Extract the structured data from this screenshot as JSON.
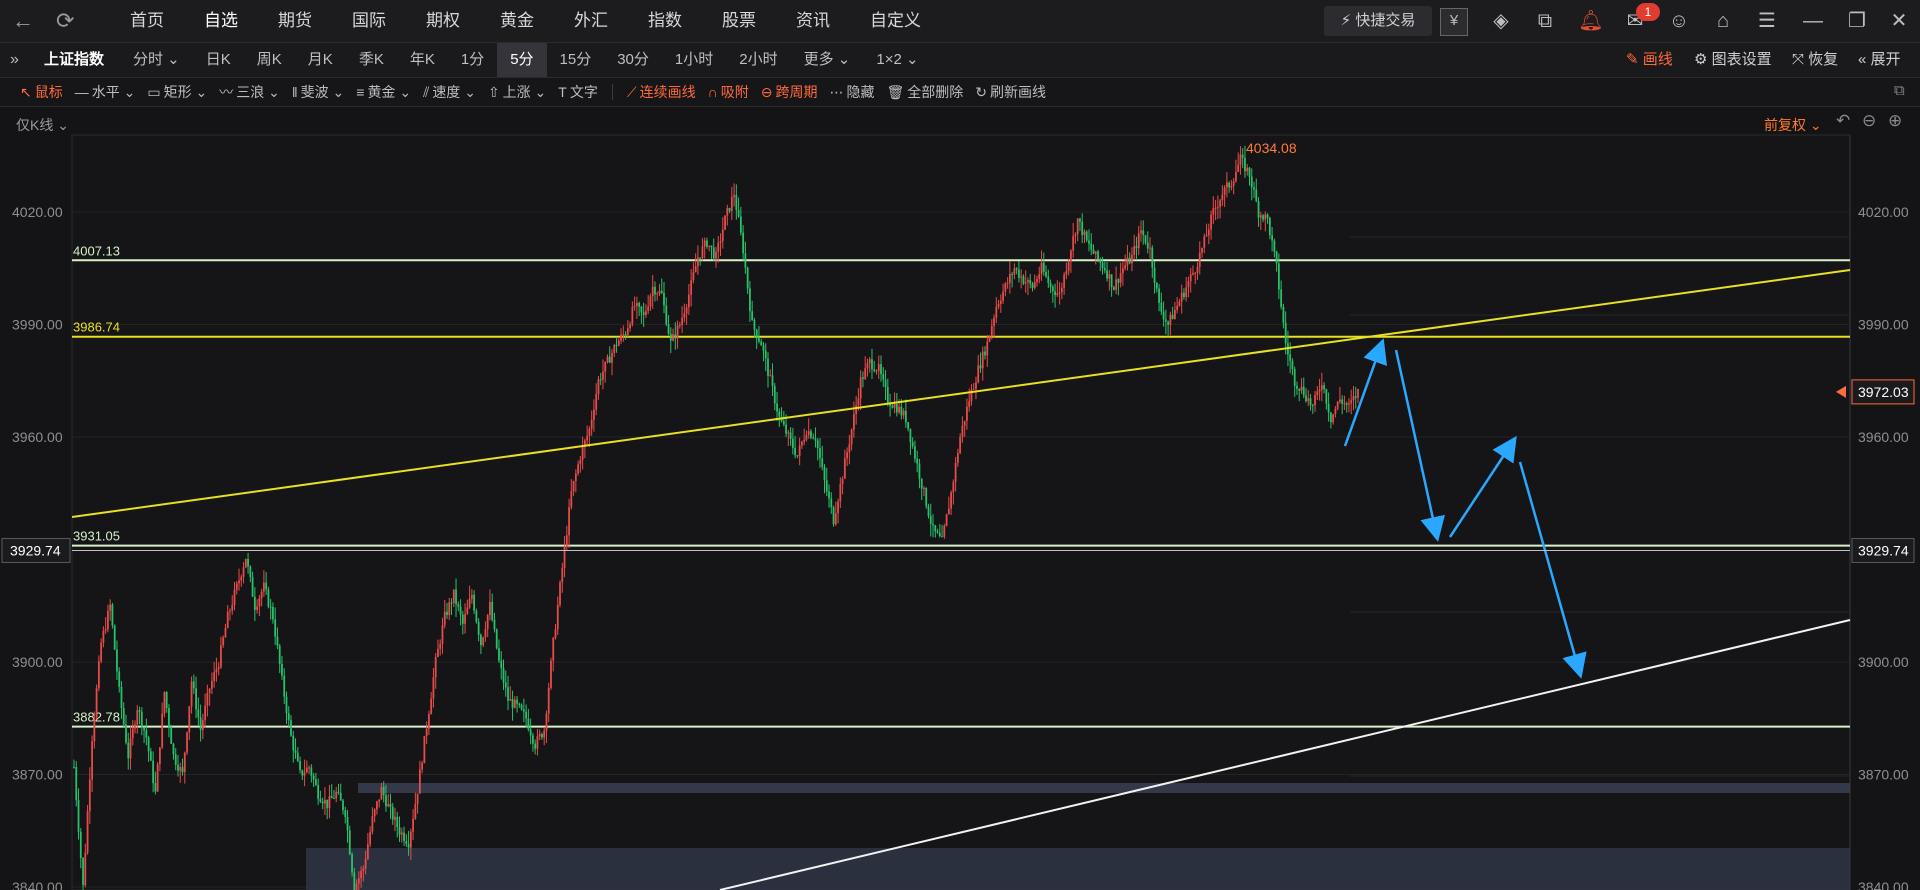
{
  "nav": {
    "back": "←",
    "refresh": "⟳",
    "tabs": [
      "首页",
      "自选",
      "期货",
      "国际",
      "期权",
      "黄金",
      "外汇",
      "指数",
      "股票",
      "资讯",
      "自定义"
    ],
    "active_tab": "自选",
    "quick_trade": "快捷交易",
    "yuan": "¥",
    "mail_badge": "1"
  },
  "period": {
    "index_name": "上证指数",
    "items": [
      "分时",
      "日K",
      "周K",
      "月K",
      "季K",
      "年K",
      "1分",
      "5分",
      "15分",
      "30分",
      "1小时",
      "2小时",
      "更多",
      "1×2"
    ],
    "active": "5分",
    "draw_line": "画线",
    "chart_settings": "图表设置",
    "restore": "恢复",
    "expand": "展开"
  },
  "draw_tools": {
    "items": [
      "鼠标",
      "水平",
      "矩形",
      "三浪",
      "斐波",
      "黄金",
      "速度",
      "上涨",
      "文字",
      "连续画线",
      "吸附",
      "跨周期",
      "隐藏",
      "全部删除",
      "刷新画线"
    ]
  },
  "chart_header": {
    "mode": "仅K线",
    "adjust": "前复权"
  },
  "chart_data": {
    "type": "candlestick",
    "title": "上证指数 5分",
    "y_ticks": [
      "4020.00",
      "3990.00",
      "3960.00",
      "3900.00",
      "3870.00",
      "3840.00"
    ],
    "y_tick_values": [
      4020,
      3990,
      3960,
      3900,
      3870,
      3840
    ],
    "ylim": [
      3838,
      4048
    ],
    "current_price": "3972.03",
    "crosshair_price": "3929.74",
    "high_label": "4034.08",
    "price_path": [
      [
        0,
        3872
      ],
      [
        4,
        3840
      ],
      [
        8,
        3880
      ],
      [
        12,
        3905
      ],
      [
        16,
        3915
      ],
      [
        20,
        3892
      ],
      [
        24,
        3875
      ],
      [
        28,
        3888
      ],
      [
        32,
        3880
      ],
      [
        36,
        3865
      ],
      [
        40,
        3892
      ],
      [
        44,
        3875
      ],
      [
        48,
        3870
      ],
      [
        52,
        3895
      ],
      [
        56,
        3882
      ],
      [
        60,
        3893
      ],
      [
        64,
        3900
      ],
      [
        68,
        3912
      ],
      [
        72,
        3920
      ],
      [
        76,
        3928
      ],
      [
        80,
        3915
      ],
      [
        84,
        3920
      ],
      [
        88,
        3912
      ],
      [
        92,
        3895
      ],
      [
        96,
        3880
      ],
      [
        100,
        3870
      ],
      [
        104,
        3872
      ],
      [
        108,
        3865
      ],
      [
        112,
        3862
      ],
      [
        116,
        3865
      ],
      [
        120,
        3860
      ],
      [
        124,
        3840
      ],
      [
        128,
        3845
      ],
      [
        132,
        3858
      ],
      [
        136,
        3866
      ],
      [
        140,
        3860
      ],
      [
        144,
        3855
      ],
      [
        148,
        3852
      ],
      [
        152,
        3866
      ],
      [
        156,
        3883
      ],
      [
        160,
        3900
      ],
      [
        164,
        3912
      ],
      [
        168,
        3918
      ],
      [
        172,
        3910
      ],
      [
        176,
        3918
      ],
      [
        180,
        3905
      ],
      [
        184,
        3915
      ],
      [
        188,
        3900
      ],
      [
        192,
        3890
      ],
      [
        196,
        3888
      ],
      [
        200,
        3885
      ],
      [
        204,
        3878
      ],
      [
        208,
        3882
      ],
      [
        212,
        3905
      ],
      [
        216,
        3925
      ],
      [
        220,
        3945
      ],
      [
        224,
        3955
      ],
      [
        228,
        3962
      ],
      [
        232,
        3975
      ],
      [
        236,
        3980
      ],
      [
        240,
        3985
      ],
      [
        244,
        3988
      ],
      [
        248,
        3995
      ],
      [
        252,
        3992
      ],
      [
        256,
        4000
      ],
      [
        260,
        3998
      ],
      [
        264,
        3985
      ],
      [
        268,
        3990
      ],
      [
        272,
        3998
      ],
      [
        276,
        4008
      ],
      [
        280,
        4012
      ],
      [
        284,
        4008
      ],
      [
        288,
        4018
      ],
      [
        292,
        4025
      ],
      [
        296,
        4010
      ],
      [
        300,
        3990
      ],
      [
        304,
        3985
      ],
      [
        308,
        3975
      ],
      [
        312,
        3965
      ],
      [
        316,
        3960
      ],
      [
        320,
        3955
      ],
      [
        324,
        3962
      ],
      [
        328,
        3960
      ],
      [
        332,
        3948
      ],
      [
        336,
        3938
      ],
      [
        340,
        3950
      ],
      [
        344,
        3962
      ],
      [
        348,
        3975
      ],
      [
        352,
        3980
      ],
      [
        356,
        3978
      ],
      [
        360,
        3970
      ],
      [
        364,
        3968
      ],
      [
        368,
        3965
      ],
      [
        372,
        3955
      ],
      [
        376,
        3945
      ],
      [
        380,
        3935
      ],
      [
        384,
        3932
      ],
      [
        388,
        3945
      ],
      [
        392,
        3960
      ],
      [
        396,
        3970
      ],
      [
        400,
        3978
      ],
      [
        404,
        3985
      ],
      [
        408,
        3995
      ],
      [
        412,
        4000
      ],
      [
        416,
        4005
      ],
      [
        420,
        4002
      ],
      [
        424,
        4000
      ],
      [
        428,
        4005
      ],
      [
        432,
        4000
      ],
      [
        436,
        3998
      ],
      [
        440,
        4008
      ],
      [
        444,
        4018
      ],
      [
        448,
        4012
      ],
      [
        452,
        4008
      ],
      [
        456,
        4005
      ],
      [
        460,
        4000
      ],
      [
        464,
        4005
      ],
      [
        468,
        4008
      ],
      [
        472,
        4015
      ],
      [
        476,
        4010
      ],
      [
        480,
        3995
      ],
      [
        484,
        3990
      ],
      [
        488,
        3995
      ],
      [
        492,
        4000
      ],
      [
        496,
        4005
      ],
      [
        500,
        4012
      ],
      [
        504,
        4020
      ],
      [
        508,
        4025
      ],
      [
        512,
        4028
      ],
      [
        516,
        4034
      ],
      [
        520,
        4030
      ],
      [
        524,
        4020
      ],
      [
        528,
        4018
      ],
      [
        532,
        4005
      ],
      [
        536,
        3985
      ],
      [
        540,
        3975
      ],
      [
        544,
        3972
      ],
      [
        548,
        3968
      ],
      [
        552,
        3975
      ],
      [
        556,
        3965
      ],
      [
        560,
        3970
      ],
      [
        564,
        3968
      ],
      [
        568,
        3972
      ]
    ],
    "horizontal_lines": [
      {
        "value": 4007.13,
        "label": "4007.13",
        "color": "#d7f0c8"
      },
      {
        "value": 3986.74,
        "label": "3986.74",
        "color": "#e8e020"
      },
      {
        "value": 3931.05,
        "label": "3931.05",
        "color": "#d7f0c8"
      },
      {
        "value": 3882.78,
        "label": "3882.78",
        "color": "#d7f0c8"
      }
    ],
    "grid": true
  }
}
